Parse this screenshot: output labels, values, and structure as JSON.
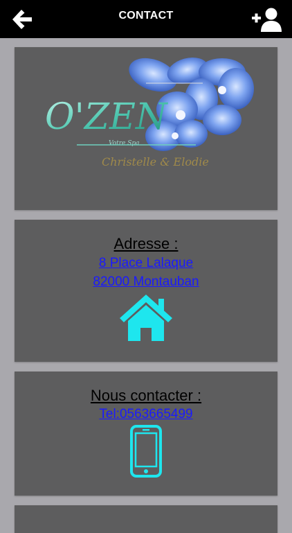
{
  "header": {
    "title": "CONTACT",
    "back_icon": "arrow-left-icon",
    "add_contact_icon": "user-plus-icon"
  },
  "logo": {
    "brand_main": "O'ZEN",
    "brand_tag": "Votre Spa",
    "brand_script": "Christelle & Elodie",
    "decoration": "blue-orchid-flowers"
  },
  "address": {
    "heading": "Adresse :",
    "line1": "8 Place Lalaque ",
    "line2": "82000 Montauban",
    "icon": "home-icon"
  },
  "contact": {
    "heading": "Nous contacter :",
    "phone": "Tel:0563665499",
    "icon": "mobile-phone-icon"
  },
  "colors": {
    "header_bg": "#000000",
    "page_bg": "#a9a8ad",
    "card_bg": "#5d5d5e",
    "link": "#1a1aff",
    "icon_accent": "#1ee6ee"
  }
}
